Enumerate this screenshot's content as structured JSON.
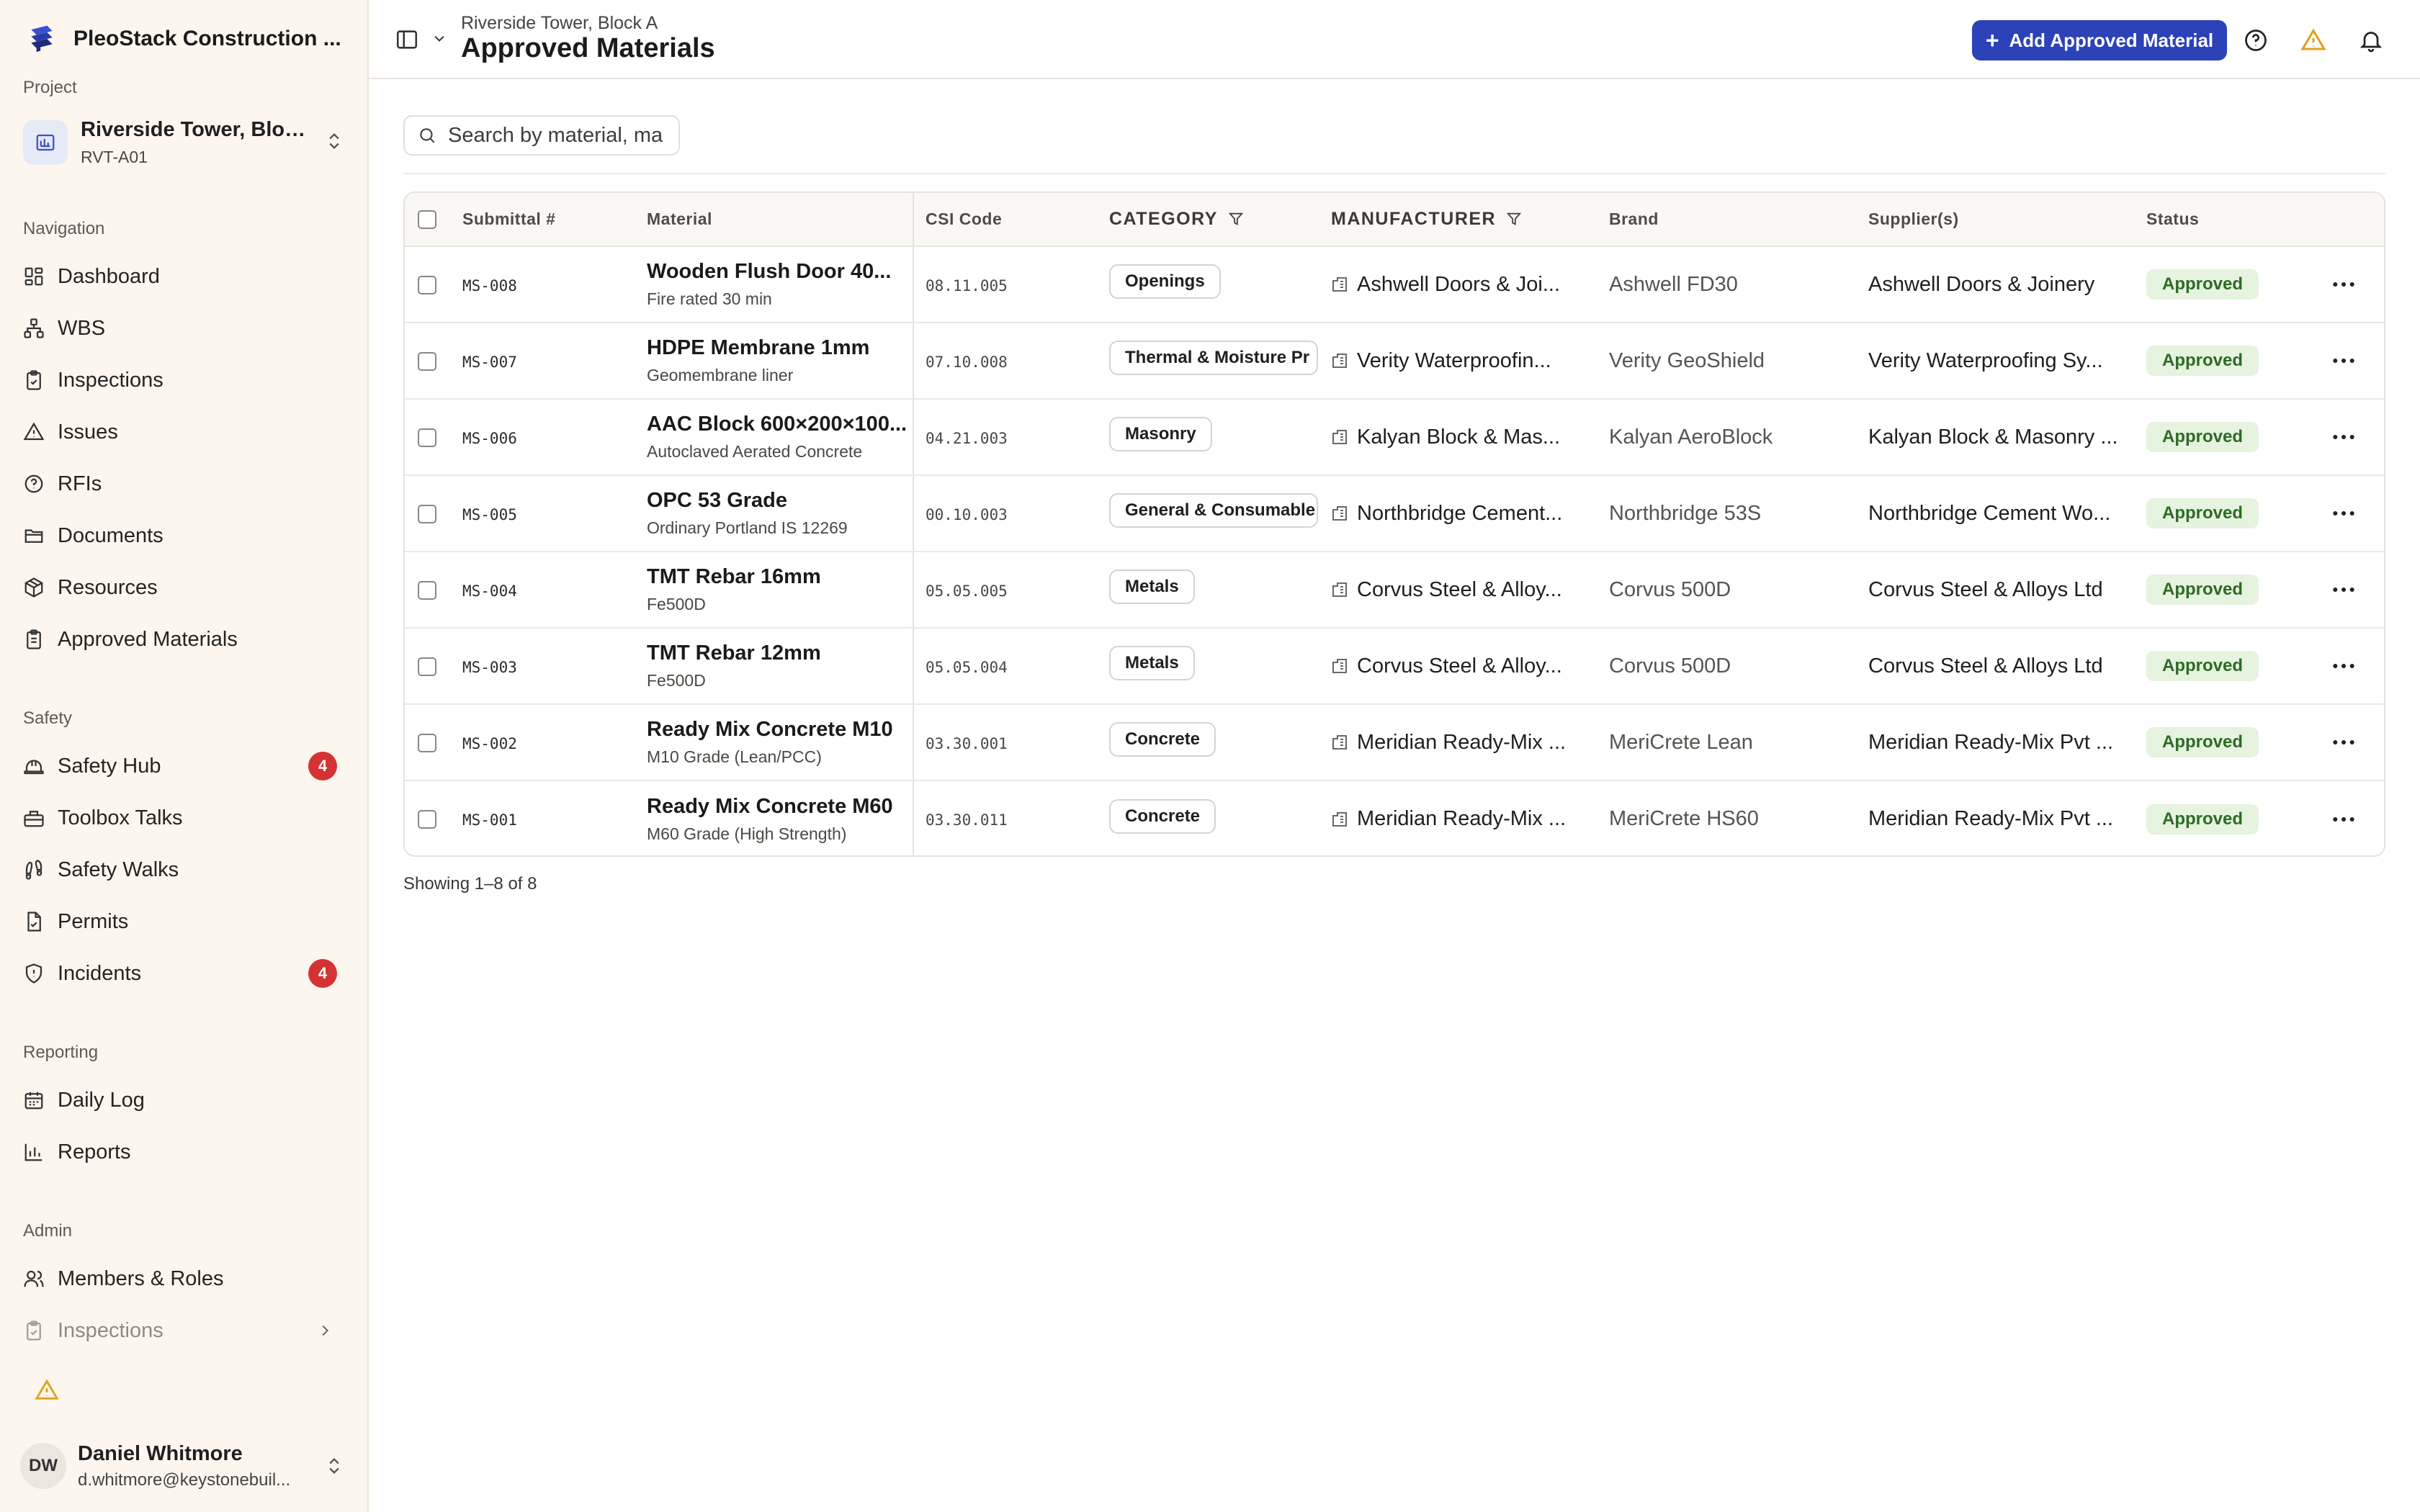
{
  "sidebar": {
    "app_name": "PleoStack Construction ...",
    "project_label": "Project",
    "project_name": "Riverside Tower, Bloc...",
    "project_code": "RVT-A01",
    "sections": {
      "navigation": "Navigation",
      "safety": "Safety",
      "reporting": "Reporting",
      "admin": "Admin"
    },
    "navigation": [
      {
        "label": "Dashboard",
        "icon": "dashboard-icon"
      },
      {
        "label": "WBS",
        "icon": "hierarchy-icon"
      },
      {
        "label": "Inspections",
        "icon": "clipboard-check-icon"
      },
      {
        "label": "Issues",
        "icon": "warning-icon"
      },
      {
        "label": "RFIs",
        "icon": "question-icon"
      },
      {
        "label": "Documents",
        "icon": "folder-icon"
      },
      {
        "label": "Resources",
        "icon": "package-icon"
      },
      {
        "label": "Approved Materials",
        "icon": "clipboard-icon"
      }
    ],
    "safety": [
      {
        "label": "Safety Hub",
        "icon": "hard-hat-icon",
        "badge": "4"
      },
      {
        "label": "Toolbox Talks",
        "icon": "toolbox-icon"
      },
      {
        "label": "Safety Walks",
        "icon": "footprints-icon"
      },
      {
        "label": "Permits",
        "icon": "file-check-icon"
      },
      {
        "label": "Incidents",
        "icon": "shield-icon",
        "badge": "4"
      }
    ],
    "reporting": [
      {
        "label": "Daily Log",
        "icon": "calendar-icon"
      },
      {
        "label": "Reports",
        "icon": "bar-chart-icon"
      }
    ],
    "admin": [
      {
        "label": "Members & Roles",
        "icon": "users-icon"
      },
      {
        "label": "Inspections",
        "icon": "clipboard-check-icon"
      }
    ],
    "user": {
      "initials": "DW",
      "name": "Daniel Whitmore",
      "email": "d.whitmore@keystonebuil..."
    }
  },
  "header": {
    "breadcrumb": "Riverside Tower, Block A",
    "title": "Approved Materials",
    "add_button": "Add Approved Material",
    "add_button_icon": "+"
  },
  "search": {
    "placeholder": "Search by material, manufacturer",
    "value": ""
  },
  "table": {
    "columns": {
      "submittal": "Submittal #",
      "material": "Material",
      "csi": "CSI Code",
      "category": "CATEGORY",
      "manufacturer": "MANUFACTURER",
      "brand": "Brand",
      "suppliers": "Supplier(s)",
      "status": "Status"
    },
    "rows": [
      {
        "submittal": "MS-008",
        "material": "Wooden Flush Door 40...",
        "material_sub": "Fire rated 30 min",
        "csi": "08.11.005",
        "category": "Openings",
        "manufacturer": "Ashwell Doors & Joi...",
        "brand": "Ashwell FD30",
        "supplier": "Ashwell Doors & Joinery",
        "status": "Approved"
      },
      {
        "submittal": "MS-007",
        "material": "HDPE Membrane 1mm",
        "material_sub": "Geomembrane liner",
        "csi": "07.10.008",
        "category": "Thermal & Moisture Pr",
        "manufacturer": "Verity Waterproofin...",
        "brand": "Verity GeoShield",
        "supplier": "Verity Waterproofing Sy...",
        "status": "Approved"
      },
      {
        "submittal": "MS-006",
        "material": "AAC Block 600×200×100...",
        "material_sub": "Autoclaved Aerated Concrete",
        "csi": "04.21.003",
        "category": "Masonry",
        "manufacturer": "Kalyan Block & Mas...",
        "brand": "Kalyan AeroBlock",
        "supplier": "Kalyan Block & Masonry ...",
        "status": "Approved"
      },
      {
        "submittal": "MS-005",
        "material": "OPC 53 Grade",
        "material_sub": "Ordinary Portland IS 12269",
        "csi": "00.10.003",
        "category": "General & Consumable",
        "manufacturer": "Northbridge Cement...",
        "brand": "Northbridge 53S",
        "supplier": "Northbridge Cement Wo...",
        "status": "Approved"
      },
      {
        "submittal": "MS-004",
        "material": "TMT Rebar 16mm",
        "material_sub": "Fe500D",
        "csi": "05.05.005",
        "category": "Metals",
        "manufacturer": "Corvus Steel & Alloy...",
        "brand": "Corvus 500D",
        "supplier": "Corvus Steel & Alloys Ltd",
        "status": "Approved"
      },
      {
        "submittal": "MS-003",
        "material": "TMT Rebar 12mm",
        "material_sub": "Fe500D",
        "csi": "05.05.004",
        "category": "Metals",
        "manufacturer": "Corvus Steel & Alloy...",
        "brand": "Corvus 500D",
        "supplier": "Corvus Steel & Alloys Ltd",
        "status": "Approved"
      },
      {
        "submittal": "MS-002",
        "material": "Ready Mix Concrete M10",
        "material_sub": "M10 Grade (Lean/PCC)",
        "csi": "03.30.001",
        "category": "Concrete",
        "manufacturer": "Meridian Ready-Mix ...",
        "brand": "MeriCrete Lean",
        "supplier": "Meridian Ready-Mix Pvt ...",
        "status": "Approved"
      },
      {
        "submittal": "MS-001",
        "material": "Ready Mix Concrete M60",
        "material_sub": "M60 Grade (High Strength)",
        "csi": "03.30.011",
        "category": "Concrete",
        "manufacturer": "Meridian Ready-Mix ...",
        "brand": "MeriCrete HS60",
        "supplier": "Meridian Ready-Mix Pvt ...",
        "status": "Approved"
      }
    ]
  },
  "footer": {
    "showing": "Showing 1–8 of 8"
  },
  "colors": {
    "accent": "#2b42b8",
    "badge": "#d53333",
    "approved_bg": "#e5f3df",
    "approved_text": "#2e6b24",
    "warning": "#e0a21b",
    "sidebar_bg": "#fcf6ef"
  }
}
